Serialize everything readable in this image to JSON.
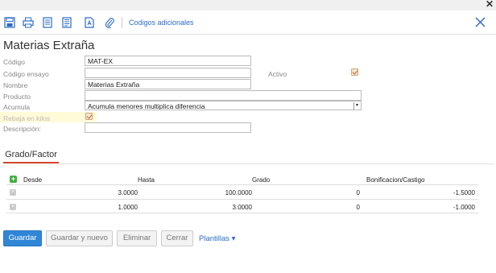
{
  "window": {
    "close_glyph": "✕"
  },
  "toolbar": {
    "icons": [
      "save-icon",
      "print-icon",
      "document-icon",
      "document-list-icon",
      "text-document-icon",
      "attachment-icon"
    ],
    "codigos_link": "Codigos adicionales",
    "close_icon": "close-icon"
  },
  "page_title": "Materias Extraña",
  "form": {
    "codigo_label": "Código",
    "codigo_value": "MAT-EX",
    "codigo_ensayo_label": "Código ensayo",
    "codigo_ensayo_value": "",
    "activo_label": "Activo",
    "activo_checked": true,
    "nombre_label": "Nombre",
    "nombre_value": "Materias Extraña",
    "producto_label": "Producto",
    "producto_value": "",
    "acumula_label": "Acumula",
    "acumula_value": "Acumula menores multiplica diferencia",
    "acumula_arrow": "▾",
    "rebaja_label": "Rebaja en kilos",
    "rebaja_checked": true,
    "descripcion_label": "Descripción:",
    "descripcion_value": ""
  },
  "tabs": {
    "grado_factor": "Grado/Factor"
  },
  "grid": {
    "add_glyph": "+",
    "delete_glyph": "×",
    "headers": {
      "desde": "Desde",
      "hasta": "Hasta",
      "grado": "Grado",
      "bonificacion": "Bonificacion/Castigo"
    },
    "rows": [
      {
        "desde": "3.0000",
        "hasta": "100.0000",
        "grado": "0",
        "bonificacion": "-1.5000"
      },
      {
        "desde": "1.0000",
        "hasta": "3.0000",
        "grado": "0",
        "bonificacion": "-1.0000"
      }
    ]
  },
  "buttons": {
    "guardar": "Guardar",
    "guardar_nuevo": "Guardar y nuevo",
    "eliminar": "Eliminar",
    "cerrar": "Cerrar",
    "plantillas": "Plantillas",
    "plantillas_arrow": "▾"
  },
  "colors": {
    "accent": "#2f86d6",
    "tab_underline": "#d0452b",
    "check": "#d0611f",
    "add": "#3fae3f"
  }
}
